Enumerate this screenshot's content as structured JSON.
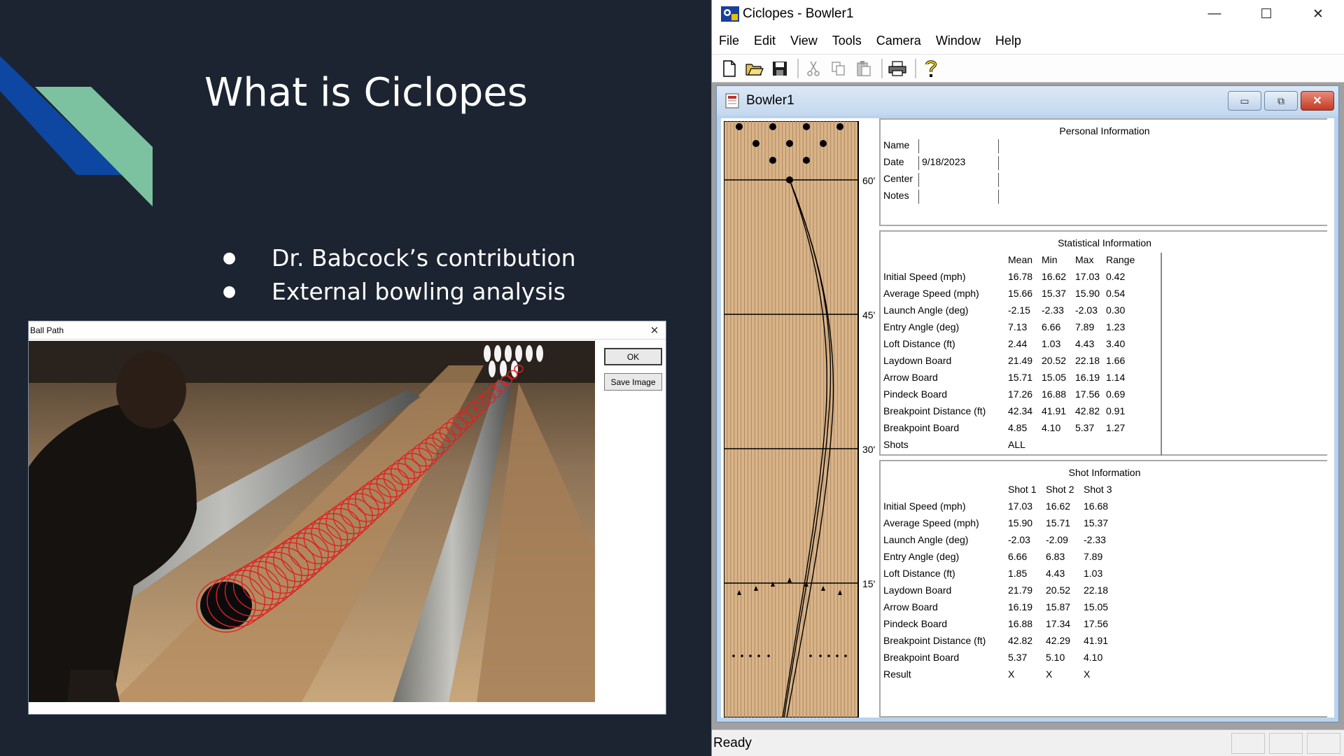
{
  "slide": {
    "title": "What is Ciclopes",
    "bullets": [
      "Dr. Babcock’s contribution",
      "External bowling analysis"
    ]
  },
  "ball_path_dialog": {
    "title": "Ball Path",
    "ok_label": "OK",
    "save_label": "Save Image",
    "close_glyph": "✕"
  },
  "app": {
    "title": "Ciclopes - Bowler1",
    "menus": [
      "File",
      "Edit",
      "View",
      "Tools",
      "Camera",
      "Window",
      "Help"
    ],
    "toolbar_icons": [
      "new-file-icon",
      "open-folder-icon",
      "save-disk-icon",
      "cut-icon",
      "copy-icon",
      "paste-icon",
      "print-icon",
      "help-icon"
    ],
    "caption": {
      "minimize": "—",
      "maximize": "☐",
      "close": "✕"
    },
    "status": "Ready"
  },
  "child": {
    "title": "Bowler1",
    "lane_markers": [
      "60'",
      "45'",
      "30'",
      "15'"
    ],
    "personal_info": {
      "title": "Personal Information",
      "fields": [
        {
          "label": "Name",
          "value": ""
        },
        {
          "label": "Date",
          "value": "9/18/2023"
        },
        {
          "label": "Center",
          "value": ""
        },
        {
          "label": "Notes",
          "value": ""
        }
      ]
    },
    "stats": {
      "title": "Statistical Information",
      "columns": [
        "Mean",
        "Min",
        "Max",
        "Range"
      ],
      "rows": [
        {
          "label": "Initial Speed (mph)",
          "values": [
            "16.78",
            "16.62",
            "17.03",
            "0.42"
          ]
        },
        {
          "label": "Average Speed (mph)",
          "values": [
            "15.66",
            "15.37",
            "15.90",
            "0.54"
          ]
        },
        {
          "label": "Launch Angle (deg)",
          "values": [
            "-2.15",
            "-2.33",
            "-2.03",
            "0.30"
          ]
        },
        {
          "label": "Entry Angle (deg)",
          "values": [
            "7.13",
            "6.66",
            "7.89",
            "1.23"
          ]
        },
        {
          "label": "Loft Distance (ft)",
          "values": [
            "2.44",
            "1.03",
            "4.43",
            "3.40"
          ]
        },
        {
          "label": "Laydown Board",
          "values": [
            "21.49",
            "20.52",
            "22.18",
            "1.66"
          ]
        },
        {
          "label": "Arrow Board",
          "values": [
            "15.71",
            "15.05",
            "16.19",
            "1.14"
          ]
        },
        {
          "label": "Pindeck Board",
          "values": [
            "17.26",
            "16.88",
            "17.56",
            "0.69"
          ]
        },
        {
          "label": "Breakpoint Distance (ft)",
          "values": [
            "42.34",
            "41.91",
            "42.82",
            "0.91"
          ]
        },
        {
          "label": "Breakpoint Board",
          "values": [
            "4.85",
            "4.10",
            "5.37",
            "1.27"
          ]
        },
        {
          "label": "Shots",
          "values": [
            "ALL",
            "",
            "",
            ""
          ]
        }
      ]
    },
    "shots": {
      "title": "Shot Information",
      "columns": [
        "Shot 1",
        "Shot 2",
        "Shot 3"
      ],
      "rows": [
        {
          "label": "Initial Speed (mph)",
          "values": [
            "17.03",
            "16.62",
            "16.68"
          ]
        },
        {
          "label": "Average Speed (mph)",
          "values": [
            "15.90",
            "15.71",
            "15.37"
          ]
        },
        {
          "label": "Launch Angle (deg)",
          "values": [
            "-2.03",
            "-2.09",
            "-2.33"
          ]
        },
        {
          "label": "Entry Angle (deg)",
          "values": [
            "6.66",
            "6.83",
            "7.89"
          ]
        },
        {
          "label": "Loft Distance (ft)",
          "values": [
            "1.85",
            "4.43",
            "1.03"
          ]
        },
        {
          "label": "Laydown Board",
          "values": [
            "21.79",
            "20.52",
            "22.18"
          ]
        },
        {
          "label": "Arrow Board",
          "values": [
            "16.19",
            "15.87",
            "15.05"
          ]
        },
        {
          "label": "Pindeck Board",
          "values": [
            "16.88",
            "17.34",
            "17.56"
          ]
        },
        {
          "label": "Breakpoint Distance (ft)",
          "values": [
            "42.82",
            "42.29",
            "41.91"
          ]
        },
        {
          "label": "Breakpoint Board",
          "values": [
            "5.37",
            "5.10",
            "4.10"
          ]
        },
        {
          "label": "Result",
          "values": [
            "X",
            "X",
            "X"
          ]
        }
      ]
    }
  },
  "colors": {
    "slide_bg": "#1c2331",
    "deco_blue": "#0d47a1",
    "deco_green": "#7cc2a0",
    "lane_wood": "#d9b48a",
    "trail_red": "#e02020",
    "child_title_bg": "#c4d8ee"
  }
}
